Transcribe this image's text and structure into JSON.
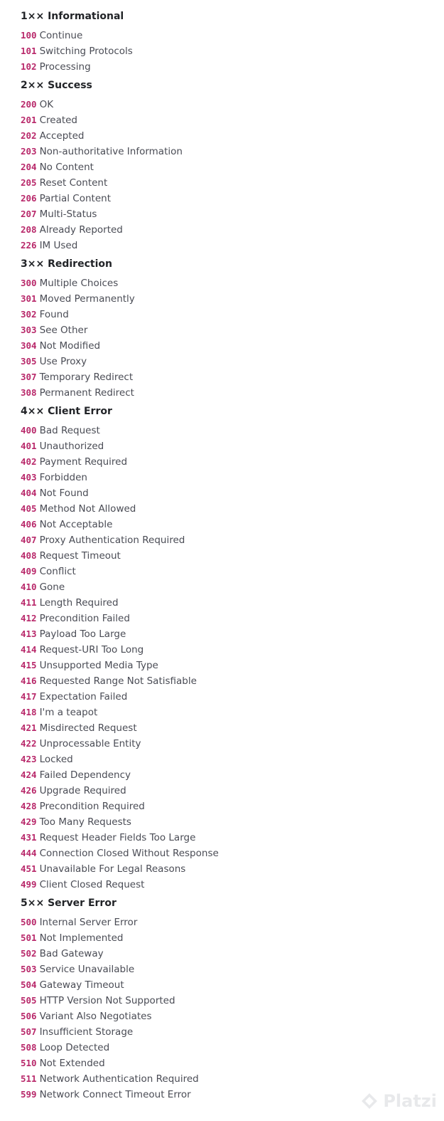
{
  "groups": [
    {
      "heading": "1×× Informational",
      "items": [
        {
          "code": "100",
          "label": "Continue"
        },
        {
          "code": "101",
          "label": "Switching Protocols"
        },
        {
          "code": "102",
          "label": "Processing"
        }
      ]
    },
    {
      "heading": "2×× Success",
      "items": [
        {
          "code": "200",
          "label": "OK"
        },
        {
          "code": "201",
          "label": "Created"
        },
        {
          "code": "202",
          "label": "Accepted"
        },
        {
          "code": "203",
          "label": "Non-authoritative Information"
        },
        {
          "code": "204",
          "label": "No Content"
        },
        {
          "code": "205",
          "label": "Reset Content"
        },
        {
          "code": "206",
          "label": "Partial Content"
        },
        {
          "code": "207",
          "label": "Multi-Status"
        },
        {
          "code": "208",
          "label": "Already Reported"
        },
        {
          "code": "226",
          "label": "IM Used"
        }
      ]
    },
    {
      "heading": "3×× Redirection",
      "items": [
        {
          "code": "300",
          "label": "Multiple Choices"
        },
        {
          "code": "301",
          "label": "Moved Permanently"
        },
        {
          "code": "302",
          "label": "Found"
        },
        {
          "code": "303",
          "label": "See Other"
        },
        {
          "code": "304",
          "label": "Not Modified"
        },
        {
          "code": "305",
          "label": "Use Proxy"
        },
        {
          "code": "307",
          "label": "Temporary Redirect"
        },
        {
          "code": "308",
          "label": "Permanent Redirect"
        }
      ]
    },
    {
      "heading": "4×× Client Error",
      "items": [
        {
          "code": "400",
          "label": "Bad Request"
        },
        {
          "code": "401",
          "label": "Unauthorized"
        },
        {
          "code": "402",
          "label": "Payment Required"
        },
        {
          "code": "403",
          "label": "Forbidden"
        },
        {
          "code": "404",
          "label": "Not Found"
        },
        {
          "code": "405",
          "label": "Method Not Allowed"
        },
        {
          "code": "406",
          "label": "Not Acceptable"
        },
        {
          "code": "407",
          "label": "Proxy Authentication Required"
        },
        {
          "code": "408",
          "label": "Request Timeout"
        },
        {
          "code": "409",
          "label": "Conflict"
        },
        {
          "code": "410",
          "label": "Gone"
        },
        {
          "code": "411",
          "label": "Length Required"
        },
        {
          "code": "412",
          "label": "Precondition Failed"
        },
        {
          "code": "413",
          "label": "Payload Too Large"
        },
        {
          "code": "414",
          "label": "Request-URI Too Long"
        },
        {
          "code": "415",
          "label": "Unsupported Media Type"
        },
        {
          "code": "416",
          "label": "Requested Range Not Satisfiable"
        },
        {
          "code": "417",
          "label": "Expectation Failed"
        },
        {
          "code": "418",
          "label": "I'm a teapot"
        },
        {
          "code": "421",
          "label": "Misdirected Request"
        },
        {
          "code": "422",
          "label": "Unprocessable Entity"
        },
        {
          "code": "423",
          "label": "Locked"
        },
        {
          "code": "424",
          "label": "Failed Dependency"
        },
        {
          "code": "426",
          "label": "Upgrade Required"
        },
        {
          "code": "428",
          "label": "Precondition Required"
        },
        {
          "code": "429",
          "label": "Too Many Requests"
        },
        {
          "code": "431",
          "label": "Request Header Fields Too Large"
        },
        {
          "code": "444",
          "label": "Connection Closed Without Response"
        },
        {
          "code": "451",
          "label": "Unavailable For Legal Reasons"
        },
        {
          "code": "499",
          "label": "Client Closed Request"
        }
      ]
    },
    {
      "heading": "5×× Server Error",
      "items": [
        {
          "code": "500",
          "label": "Internal Server Error"
        },
        {
          "code": "501",
          "label": "Not Implemented"
        },
        {
          "code": "502",
          "label": "Bad Gateway"
        },
        {
          "code": "503",
          "label": "Service Unavailable"
        },
        {
          "code": "504",
          "label": "Gateway Timeout"
        },
        {
          "code": "505",
          "label": "HTTP Version Not Supported"
        },
        {
          "code": "506",
          "label": "Variant Also Negotiates"
        },
        {
          "code": "507",
          "label": "Insufficient Storage"
        },
        {
          "code": "508",
          "label": "Loop Detected"
        },
        {
          "code": "510",
          "label": "Not Extended"
        },
        {
          "code": "511",
          "label": "Network Authentication Required"
        },
        {
          "code": "599",
          "label": "Network Connect Timeout Error"
        }
      ]
    }
  ],
  "watermark": {
    "text": "Platzi",
    "icon": "platzi-logo-icon"
  },
  "colors": {
    "code": "#b8286a",
    "label": "#4a4c55",
    "heading": "#222428",
    "background": "#ffffff"
  }
}
